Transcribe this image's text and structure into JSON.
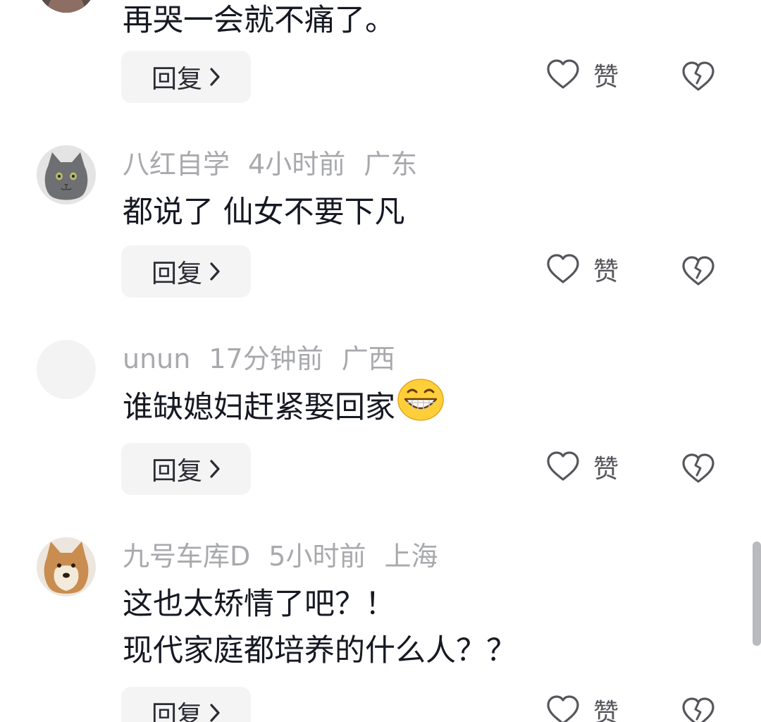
{
  "comments": [
    {
      "body": [
        "再哭一会就不痛了。"
      ],
      "reply_label": "回复",
      "like_label": "赞"
    },
    {
      "username": "八红自学",
      "time": "4小时前",
      "location": "广东",
      "body": [
        "都说了 仙女不要下凡"
      ],
      "reply_label": "回复",
      "like_label": "赞"
    },
    {
      "username": "unun",
      "time": "17分钟前",
      "location": "广西",
      "body": [
        "谁缺媳妇赶紧娶回家"
      ],
      "reply_label": "回复",
      "like_label": "赞"
    },
    {
      "username": "九号车库D",
      "time": "5小时前",
      "location": "上海",
      "body": [
        "这也太矫情了吧？！",
        "现代家庭都培养的什么人？？"
      ],
      "reply_label": "回复",
      "like_label": "赞"
    }
  ],
  "colors": {
    "username": "#a8a9ad",
    "text": "#161823",
    "reply_bg": "#f4f4f5",
    "icon_stroke": "#55565c"
  },
  "icons": [
    "chevron-right-icon",
    "heart-icon",
    "broken-heart-icon",
    "grinning-emoji-icon"
  ]
}
